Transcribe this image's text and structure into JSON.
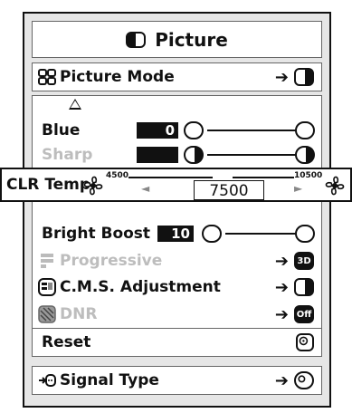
{
  "title": "Picture",
  "picture_mode": {
    "label": "Picture Mode",
    "arrow": "➔"
  },
  "blue": {
    "label": "Blue",
    "value": "0"
  },
  "sharp": {
    "label": "Sharp"
  },
  "clr_temp": {
    "label": "CLR Temp",
    "min": "4500",
    "max": "10500",
    "value": "7500",
    "left_arrow": "◄",
    "right_arrow": "►"
  },
  "bright_boost": {
    "label": "Bright Boost",
    "value": "10"
  },
  "progressive": {
    "label": "Progressive",
    "arrow": "➔",
    "mode": "3D"
  },
  "cms": {
    "label": "C.M.S. Adjustment",
    "arrow": "➔"
  },
  "dnr": {
    "label": "DNR",
    "arrow": "➔",
    "mode": "Off"
  },
  "reset": {
    "label": "Reset"
  },
  "signal_type": {
    "label": "Signal Type",
    "arrow": "➔"
  }
}
